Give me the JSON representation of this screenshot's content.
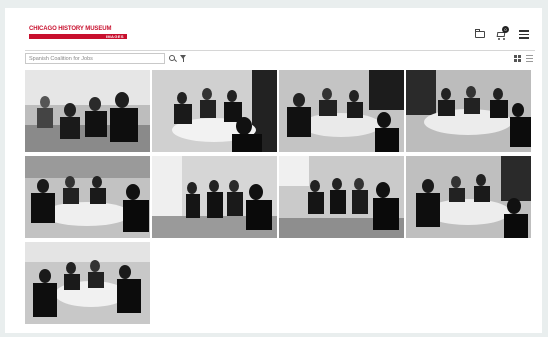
{
  "header": {
    "logo_top": "CHICAGO HISTORY MUSEUM",
    "logo_bottom": "IMAGES",
    "cart_count": "0"
  },
  "search": {
    "placeholder": "Spanish Coalition for Jobs"
  },
  "icons": [
    "folder-icon",
    "cart-icon",
    "menu-icon",
    "search-icon",
    "filter-icon",
    "grid-view-icon",
    "list-view-icon"
  ],
  "colors": {
    "brand_red": "#c8102e",
    "background": "#e9eeee"
  },
  "thumbnails": [
    {
      "id": 1
    },
    {
      "id": 2
    },
    {
      "id": 3
    },
    {
      "id": 4
    },
    {
      "id": 5
    },
    {
      "id": 6
    },
    {
      "id": 7
    },
    {
      "id": 8
    },
    {
      "id": 9
    }
  ]
}
